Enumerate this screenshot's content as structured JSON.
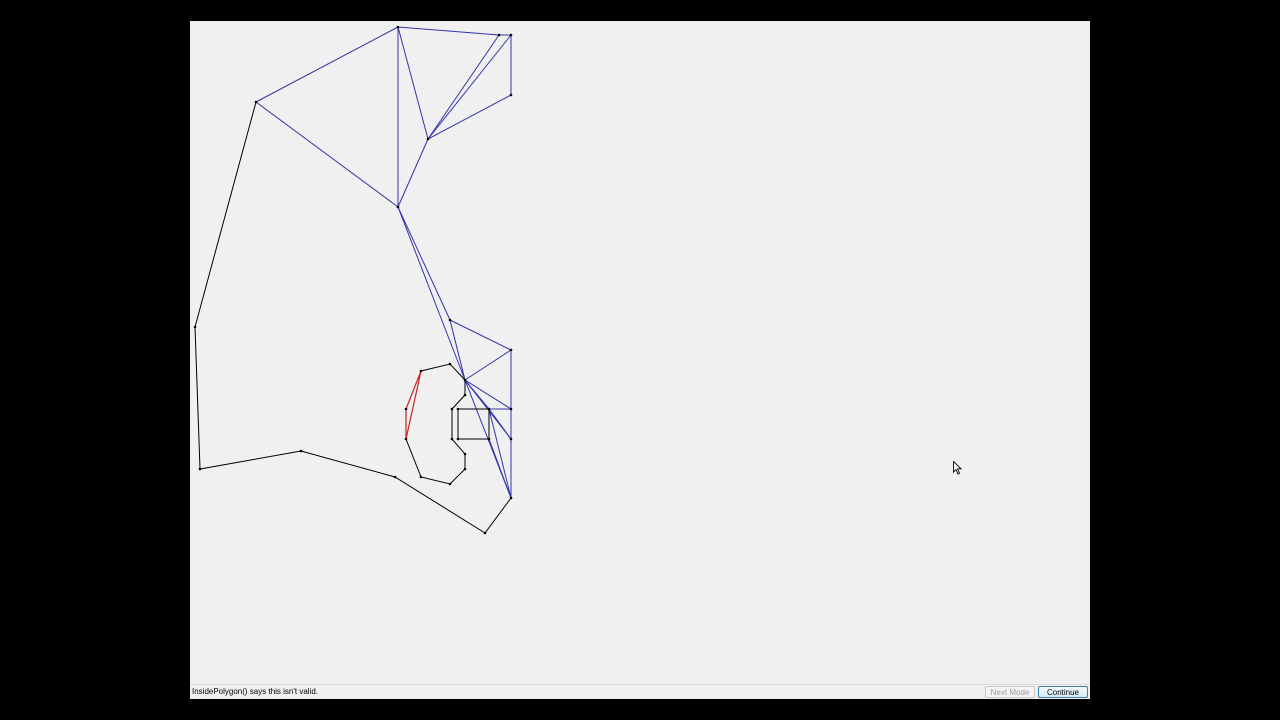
{
  "status_bar": {
    "message": "InsidePolygon() says this isn't valid."
  },
  "buttons": {
    "next_mode": "Next Mode",
    "continue": "Continue"
  },
  "colors": {
    "background": "#000000",
    "window": "#f0f0f0",
    "polygon_edge": "#000000",
    "triangulation_edge": "#3333aa",
    "invalid_edge": "#cc2222"
  }
}
